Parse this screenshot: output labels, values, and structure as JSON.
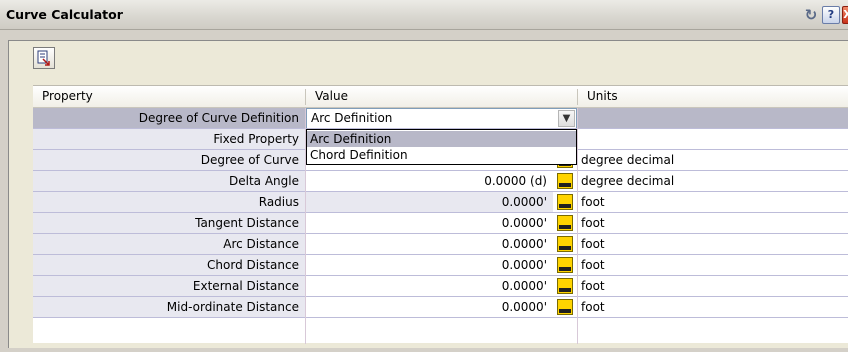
{
  "window": {
    "title": "Curve Calculator",
    "pin_icon": "pin-icon",
    "help_label": "?",
    "close_label": "X"
  },
  "toolbar": {
    "button_icon": "insert-in-drawing-icon"
  },
  "table": {
    "headers": [
      "Property",
      "Value",
      "Units"
    ],
    "dropdown_row": {
      "property": "Degree of Curve Definition",
      "value": "Arc Definition",
      "options": [
        "Arc Definition",
        "Chord Definition"
      ],
      "highlighted_option": "Arc Definition"
    },
    "fixed_row": {
      "property": "Fixed Property"
    },
    "rows": [
      {
        "property": "Degree of Curve",
        "value": "",
        "unit": "degree decimal"
      },
      {
        "property": "Delta Angle",
        "value": "0.0000 (d)",
        "unit": "degree decimal"
      },
      {
        "property": "Radius",
        "value": "0.0000'",
        "unit": "foot"
      },
      {
        "property": "Tangent Distance",
        "value": "0.0000'",
        "unit": "foot"
      },
      {
        "property": "Arc Distance",
        "value": "0.0000'",
        "unit": "foot"
      },
      {
        "property": "Chord Distance",
        "value": "0.0000'",
        "unit": "foot"
      },
      {
        "property": "External Distance",
        "value": "0.0000'",
        "unit": "foot"
      },
      {
        "property": "Mid-ordinate Distance",
        "value": "0.0000'",
        "unit": "foot"
      }
    ]
  },
  "colors": {
    "property_bg": "#e8e8f0",
    "selected_bg": "#b8b8c8",
    "grid_line": "#bdbcd9"
  }
}
